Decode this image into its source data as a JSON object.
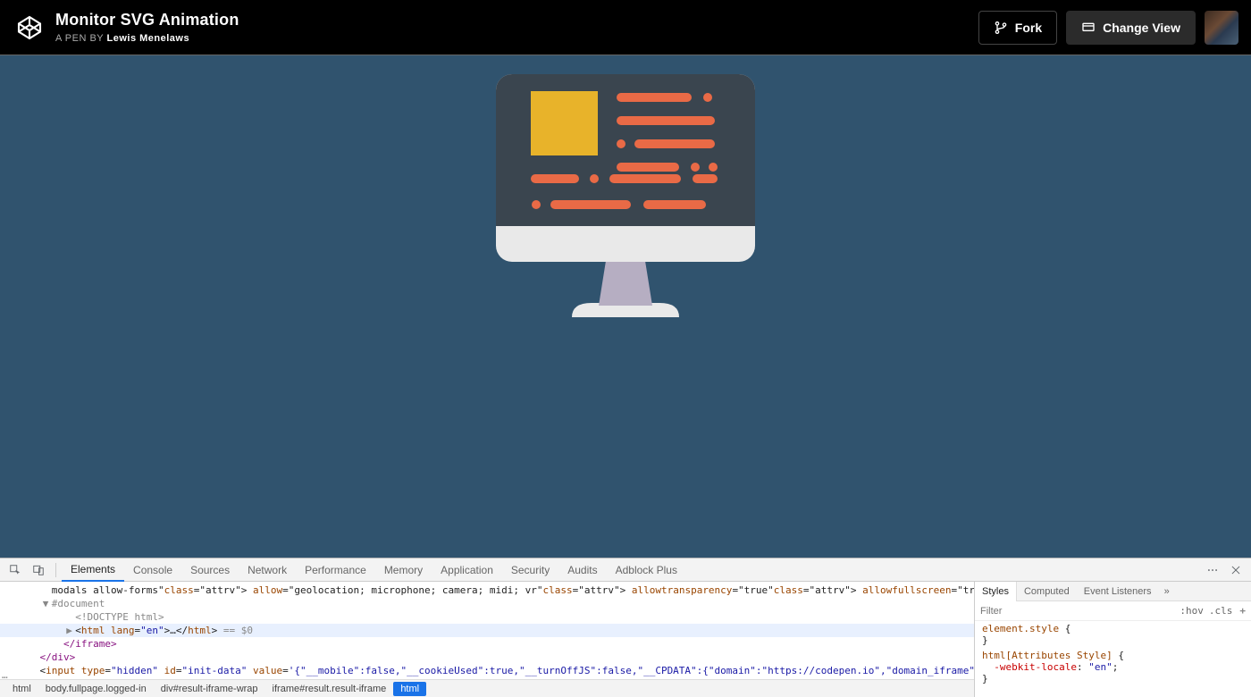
{
  "header": {
    "title": "Monitor SVG Animation",
    "byline_prefix": "A PEN BY ",
    "author": "Lewis Menelaws",
    "fork_label": "Fork",
    "change_view_label": "Change View"
  },
  "devtools": {
    "tabs": [
      "Elements",
      "Console",
      "Sources",
      "Network",
      "Performance",
      "Memory",
      "Application",
      "Security",
      "Audits",
      "Adblock Plus"
    ],
    "active_tab": "Elements",
    "dom_lines": [
      {
        "indent": 3,
        "text": "modals allow-forms\" allow=\"geolocation; microphone; camera; midi; vr\" allowtransparency=\"true\" allowfullscreen=\"true\" class=\"result-iframe\">",
        "type": "attrs"
      },
      {
        "indent": 3,
        "tri": "▼",
        "text": "#document",
        "type": "doc"
      },
      {
        "indent": 5,
        "text": "<!DOCTYPE html>",
        "type": "doctype"
      },
      {
        "indent": 5,
        "tri": "▶",
        "text": "<html lang=\"en\">…</html> == $0",
        "type": "selected"
      },
      {
        "indent": 4,
        "text": "</iframe>",
        "type": "tag"
      },
      {
        "indent": 2,
        "text": "</div>",
        "type": "tag"
      },
      {
        "indent": 2,
        "tri": "",
        "text": "<input type=\"hidden\" id=\"init-data\" value='{\"__mobile\":false,\"__cookieUsed\":true,\"__turnOffJS\":false,\"__CPDATA\":{\"domain\":\"https://codepen.io\",\"domain_iframe\":",
        "type": "input"
      }
    ],
    "gutter": "…",
    "breadcrumb": [
      "html",
      "body.fullpage.logged-in",
      "div#result-iframe-wrap",
      "iframe#result.result-iframe",
      "html"
    ],
    "breadcrumb_active_index": 4,
    "styles": {
      "tabs": [
        "Styles",
        "Computed",
        "Event Listeners"
      ],
      "filter_placeholder": "Filter",
      "hov": ":hov",
      "cls": ".cls",
      "rule1_sel": "element.style",
      "rule2_sel": "html[Attributes Style]",
      "rule2_prop": "-webkit-locale",
      "rule2_val": "\"en\""
    }
  }
}
